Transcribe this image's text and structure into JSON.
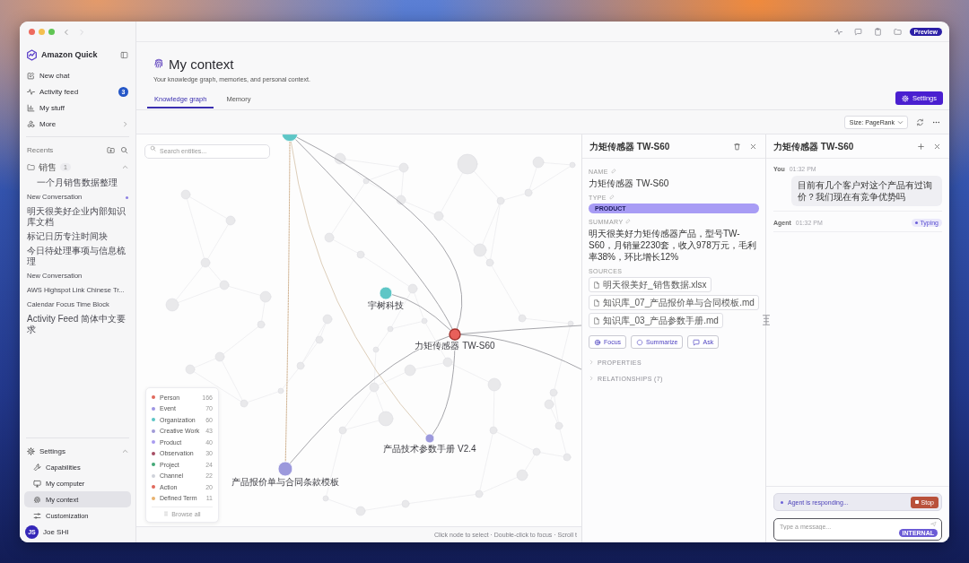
{
  "window": {
    "back": {
      "disabled": false
    },
    "forward": {
      "disabled": true
    }
  },
  "sidebar": {
    "app_name": "Amazon Quick",
    "nav": [
      {
        "label": "New chat",
        "kind": "link"
      },
      {
        "label": "Activity feed",
        "kind": "link",
        "badge": "3"
      },
      {
        "label": "My stuff",
        "kind": "link"
      },
      {
        "label": "More",
        "kind": "submenu"
      }
    ],
    "recents_label": "Recents",
    "folder": {
      "label": "销售",
      "count": "1",
      "expanded": true,
      "items": [
        "一个月销售数据整理"
      ]
    },
    "recents": [
      {
        "label": "New Conversation",
        "unread": true
      },
      {
        "label": "明天很美好企业内部知识库文档",
        "unread": false
      },
      {
        "label": "标记日历专注时间块",
        "unread": false
      },
      {
        "label": "今日待处理事项与信息梳理",
        "unread": false
      },
      {
        "label": "New Conversation",
        "unread": false
      },
      {
        "label": "AWS Highspot Link Chinese Tr...",
        "unread": false
      },
      {
        "label": "Calendar Focus Time Block",
        "unread": false
      },
      {
        "label": "Activity Feed 简体中文要求",
        "unread": false
      }
    ],
    "settings": {
      "label": "Settings",
      "expanded": true,
      "items": [
        {
          "label": "Capabilities",
          "selected": false
        },
        {
          "label": "My computer",
          "selected": false
        },
        {
          "label": "My context",
          "selected": true
        },
        {
          "label": "Customization",
          "selected": false
        }
      ]
    },
    "user": {
      "initials": "JS",
      "name": "Joe SHI"
    }
  },
  "toolbar": {
    "badge": "Preview"
  },
  "page": {
    "title": "My context",
    "subtitle": "Your knowledge graph, memories, and personal context.",
    "tabs": [
      {
        "label": "Knowledge graph",
        "selected": true
      },
      {
        "label": "Memory",
        "selected": false
      }
    ],
    "settings_button": "Settings",
    "size_select": {
      "value": "Size: PageRank"
    }
  },
  "graph": {
    "search": {
      "placeholder": "Search entities..."
    },
    "nodes": [
      {
        "color": "#5ec6c6",
        "selected": false
      },
      {
        "label": "宇树科技",
        "color": "#5ec6c6",
        "selected": false
      },
      {
        "label": "力矩传感器 TW-S60",
        "color": "#e8605a",
        "selected": true
      },
      {
        "label": "产品技术参数手册 V2.4",
        "color": "#9c99dc",
        "selected": false
      },
      {
        "label": "产品报价单与合同条款模板",
        "color": "#9c99dc",
        "selected": false
      }
    ],
    "legend": [
      {
        "label": "Person",
        "count": "166",
        "color": "#e0685c"
      },
      {
        "label": "Event",
        "count": "70",
        "color": "#9d95e3"
      },
      {
        "label": "Organization",
        "count": "60",
        "color": "#5cc5c5"
      },
      {
        "label": "Creative Work",
        "count": "43",
        "color": "#a09ad6"
      },
      {
        "label": "Product",
        "count": "40",
        "color": "#a99cf0"
      },
      {
        "label": "Observation",
        "count": "30",
        "color": "#a64d64"
      },
      {
        "label": "Project",
        "count": "24",
        "color": "#43a877"
      },
      {
        "label": "Channel",
        "count": "22",
        "color": "#cfd2da"
      },
      {
        "label": "Action",
        "count": "20",
        "color": "#e0685c"
      },
      {
        "label": "Defined Term",
        "count": "11",
        "color": "#e8b26e"
      }
    ],
    "browse_all": "Browse all",
    "status": "Click node to select · Double-click to focus · Scroll t"
  },
  "detail": {
    "title": "力矩传感器 TW-S60",
    "fields": [
      {
        "label": "NAME",
        "kind": "text",
        "value": "力矩传感器 TW-S60"
      },
      {
        "label": "TYPE",
        "kind": "badge",
        "value": "PRODUCT"
      },
      {
        "label": "SUMMARY",
        "kind": "text",
        "value": "明天很美好力矩传感器产品，型号TW-S60，月销量2230套，收入978万元，毛利率38%，环比增长12%"
      }
    ],
    "sources_label": "SOURCES",
    "sources": [
      "明天很美好_销售数据.xlsx",
      "知识库_07_产品报价单与合同模板.md",
      "知识库_03_产品参数手册.md"
    ],
    "actions": [
      "Focus",
      "Summarize",
      "Ask"
    ],
    "sections": [
      {
        "label": "PROPERTIES",
        "expanded": false
      },
      {
        "label": "RELATIONSHIPS (7)",
        "expanded": false
      }
    ]
  },
  "chat": {
    "title": "力矩传感器 TW-S60",
    "messages": [
      {
        "kind": "user",
        "author": "You",
        "time": "01:32 PM",
        "text": "目前有几个客户对这个产品有过询价？我们现在有竞争优势吗"
      },
      {
        "kind": "agent",
        "author": "Agent",
        "time": "01:32 PM",
        "status": "Typing"
      }
    ],
    "responding": "Agent is responding...",
    "stop_button": "Stop",
    "input": {
      "placeholder": "Type a message..."
    },
    "badge": "INTERNAL"
  }
}
